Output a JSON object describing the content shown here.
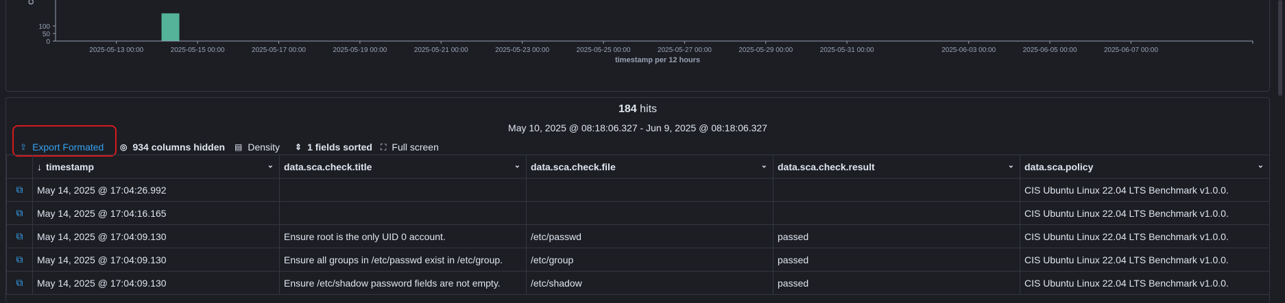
{
  "chart_data": {
    "type": "bar",
    "ylabel": "Co",
    "xlabel": "timestamp per 12 hours",
    "y_ticks": [
      "100",
      "50",
      "0"
    ],
    "x_ticks": [
      "2025-05-13 00:00",
      "2025-05-15 00:00",
      "2025-05-17 00:00",
      "2025-05-19 00:00",
      "2025-05-21 00:00",
      "2025-05-23 00:00",
      "2025-05-25 00:00",
      "2025-05-27 00:00",
      "2025-05-29 00:00",
      "2025-05-31 00:00",
      "2025-06-03 00:00",
      "2025-06-05 00:00",
      "2025-06-07 00:00"
    ],
    "bar_color": "#54b399",
    "visible_bars": [
      {
        "x": "2025-05-14 12:00",
        "value": 184
      }
    ]
  },
  "results": {
    "hits_count": "184",
    "hits_label": "hits",
    "time_range": "May 10, 2025 @ 08:18:06.327 - Jun 9, 2025 @ 08:18:06.327"
  },
  "toolbar": {
    "export_label": "Export Formated",
    "columns_hidden_label": "934 columns hidden",
    "density_label": "Density",
    "sorted_label": "1 fields sorted",
    "fullscreen_label": "Full screen"
  },
  "table": {
    "columns": [
      "timestamp",
      "data.sca.check.title",
      "data.sca.check.file",
      "data.sca.check.result",
      "data.sca.policy"
    ],
    "rows": [
      [
        "May 14, 2025 @ 17:04:26.992",
        "",
        "",
        "",
        "CIS Ubuntu Linux 22.04 LTS Benchmark v1.0.0."
      ],
      [
        "May 14, 2025 @ 17:04:16.165",
        "",
        "",
        "",
        "CIS Ubuntu Linux 22.04 LTS Benchmark v1.0.0."
      ],
      [
        "May 14, 2025 @ 17:04:09.130",
        "Ensure root is the only UID 0 account.",
        "/etc/passwd",
        "passed",
        "CIS Ubuntu Linux 22.04 LTS Benchmark v1.0.0."
      ],
      [
        "May 14, 2025 @ 17:04:09.130",
        "Ensure all groups in /etc/passwd exist in /etc/group.",
        "/etc/group",
        "passed",
        "CIS Ubuntu Linux 22.04 LTS Benchmark v1.0.0."
      ],
      [
        "May 14, 2025 @ 17:04:09.130",
        "Ensure /etc/shadow password fields are not empty.",
        "/etc/shadow",
        "passed",
        "CIS Ubuntu Linux 22.04 LTS Benchmark v1.0.0."
      ]
    ]
  },
  "colors": {
    "accent": "#36a2ef",
    "highlight_border": "#d7191c",
    "background": "#1d1e24"
  }
}
